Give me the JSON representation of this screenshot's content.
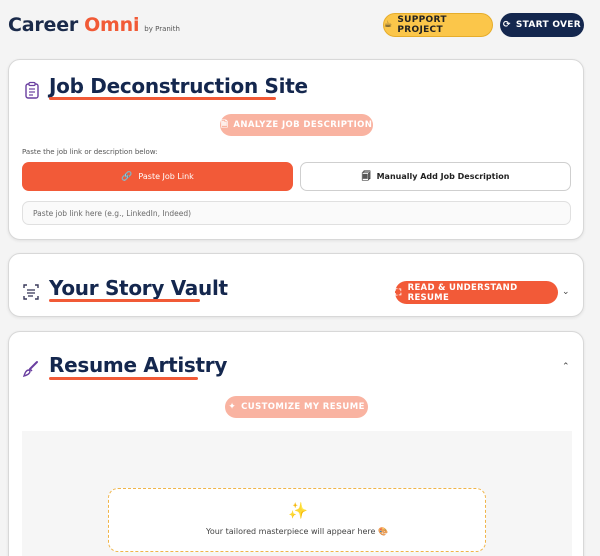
{
  "header": {
    "brand_part1": "Career",
    "brand_part2": "Omni",
    "brand_byline": "by Pranith",
    "support_label": "SUPPORT PROJECT",
    "start_over_label": "START OVER"
  },
  "job_section": {
    "title": "Job Deconstruction Site",
    "analyze_label": "ANALYZE JOB DESCRIPTION",
    "paste_instruction": "Paste the job link or description below:",
    "paste_link_label": "Paste Job Link",
    "manual_label": "Manually Add Job Description",
    "link_placeholder": "Paste job link here (e.g., LinkedIn, Indeed)"
  },
  "story_section": {
    "title": "Your Story Vault",
    "read_label": "READ & UNDERSTAND RESUME"
  },
  "artistry_section": {
    "title": "Resume Artistry",
    "customize_label": "CUSTOMIZE MY RESUME",
    "placeholder_text": "Your tailored masterpiece will appear here 🎨"
  },
  "colors": {
    "accent": "#f15a36",
    "navy": "#14274e",
    "support_yellow": "#fbc64a",
    "faded_accent": "#f9b3a1"
  }
}
